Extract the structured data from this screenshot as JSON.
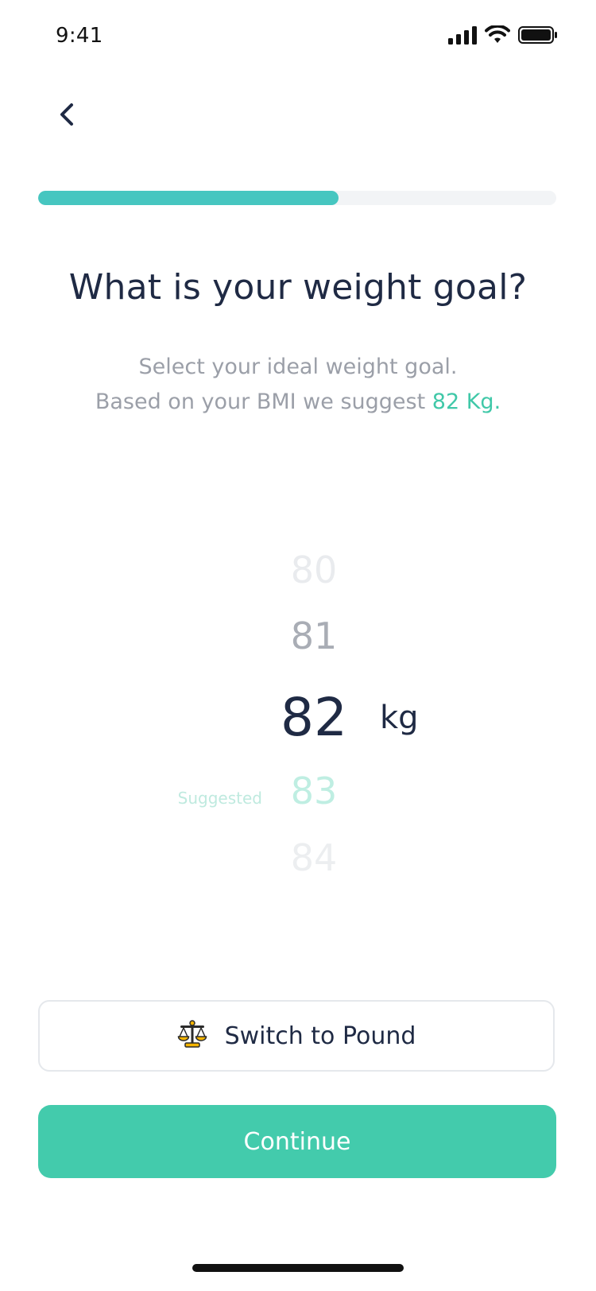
{
  "status_bar": {
    "time": "9:41",
    "icons": [
      "signal-icon",
      "wifi-icon",
      "battery-icon"
    ]
  },
  "navigation": {
    "back_icon": "chevron-left-icon"
  },
  "progress": {
    "value": 0.58,
    "colors": {
      "fill": "#46c6c0",
      "track": "#f2f4f6"
    }
  },
  "page": {
    "title": "What is your weight goal?",
    "subtitle_line1": "Select your ideal weight goal.",
    "subtitle_line2_prefix": "Based on your BMI we suggest ",
    "suggested_value_text": "82 Kg",
    "subtitle_line2_suffix": "."
  },
  "picker": {
    "values": [
      "80",
      "81",
      "82",
      "83",
      "84"
    ],
    "selected": "82",
    "unit": "kg",
    "suggested_label": "Suggested"
  },
  "buttons": {
    "switch_label": "Switch to Pound",
    "switch_icon": "scale-icon",
    "continue_label": "Continue"
  },
  "colors": {
    "accent": "#43cbac",
    "title": "#1f2a44",
    "muted": "#9b9fa8"
  }
}
